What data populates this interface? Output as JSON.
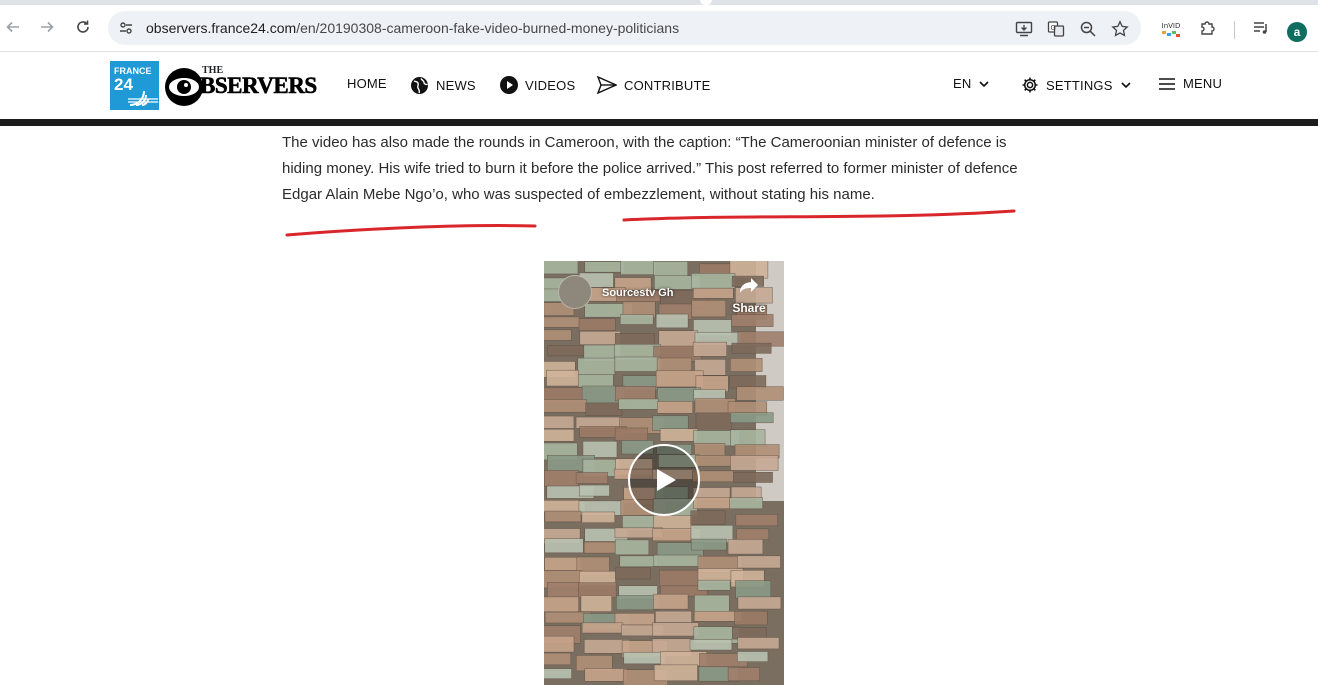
{
  "browser": {
    "url_host": "observers.france24.com",
    "url_path": "/en/20190308-cameroon-fake-video-burned-money-politicians",
    "extension_invid_label": "InVID",
    "profile_initial": "a"
  },
  "site": {
    "logo_france24_top": "FRANCE",
    "logo_france24_num": "24",
    "logo_observers_the": "THE",
    "logo_observers_word": "BSERVERS",
    "nav": {
      "home": "HOME",
      "news": "NEWS",
      "videos": "VIDEOS",
      "contribute": "CONTRIBUTE",
      "language": "EN",
      "settings": "SETTINGS",
      "menu": "MENU"
    }
  },
  "article": {
    "paragraph": "The video has also made the rounds in Cameroon, with the caption: “The Cameroonian minister of defence is hiding money. His wife tried to burn it before the police arrived.” This post referred to former minister of defence Edgar Alain Mebe Ngo’o, who was suspected of embezzlement, without stating his name."
  },
  "video": {
    "channel_name": "Sourcestv Gh",
    "share_label": "Share"
  },
  "colors": {
    "france24_blue": "#1f9ad6",
    "annotation_red": "#d9262b",
    "header_rule": "#1c1c1c"
  }
}
